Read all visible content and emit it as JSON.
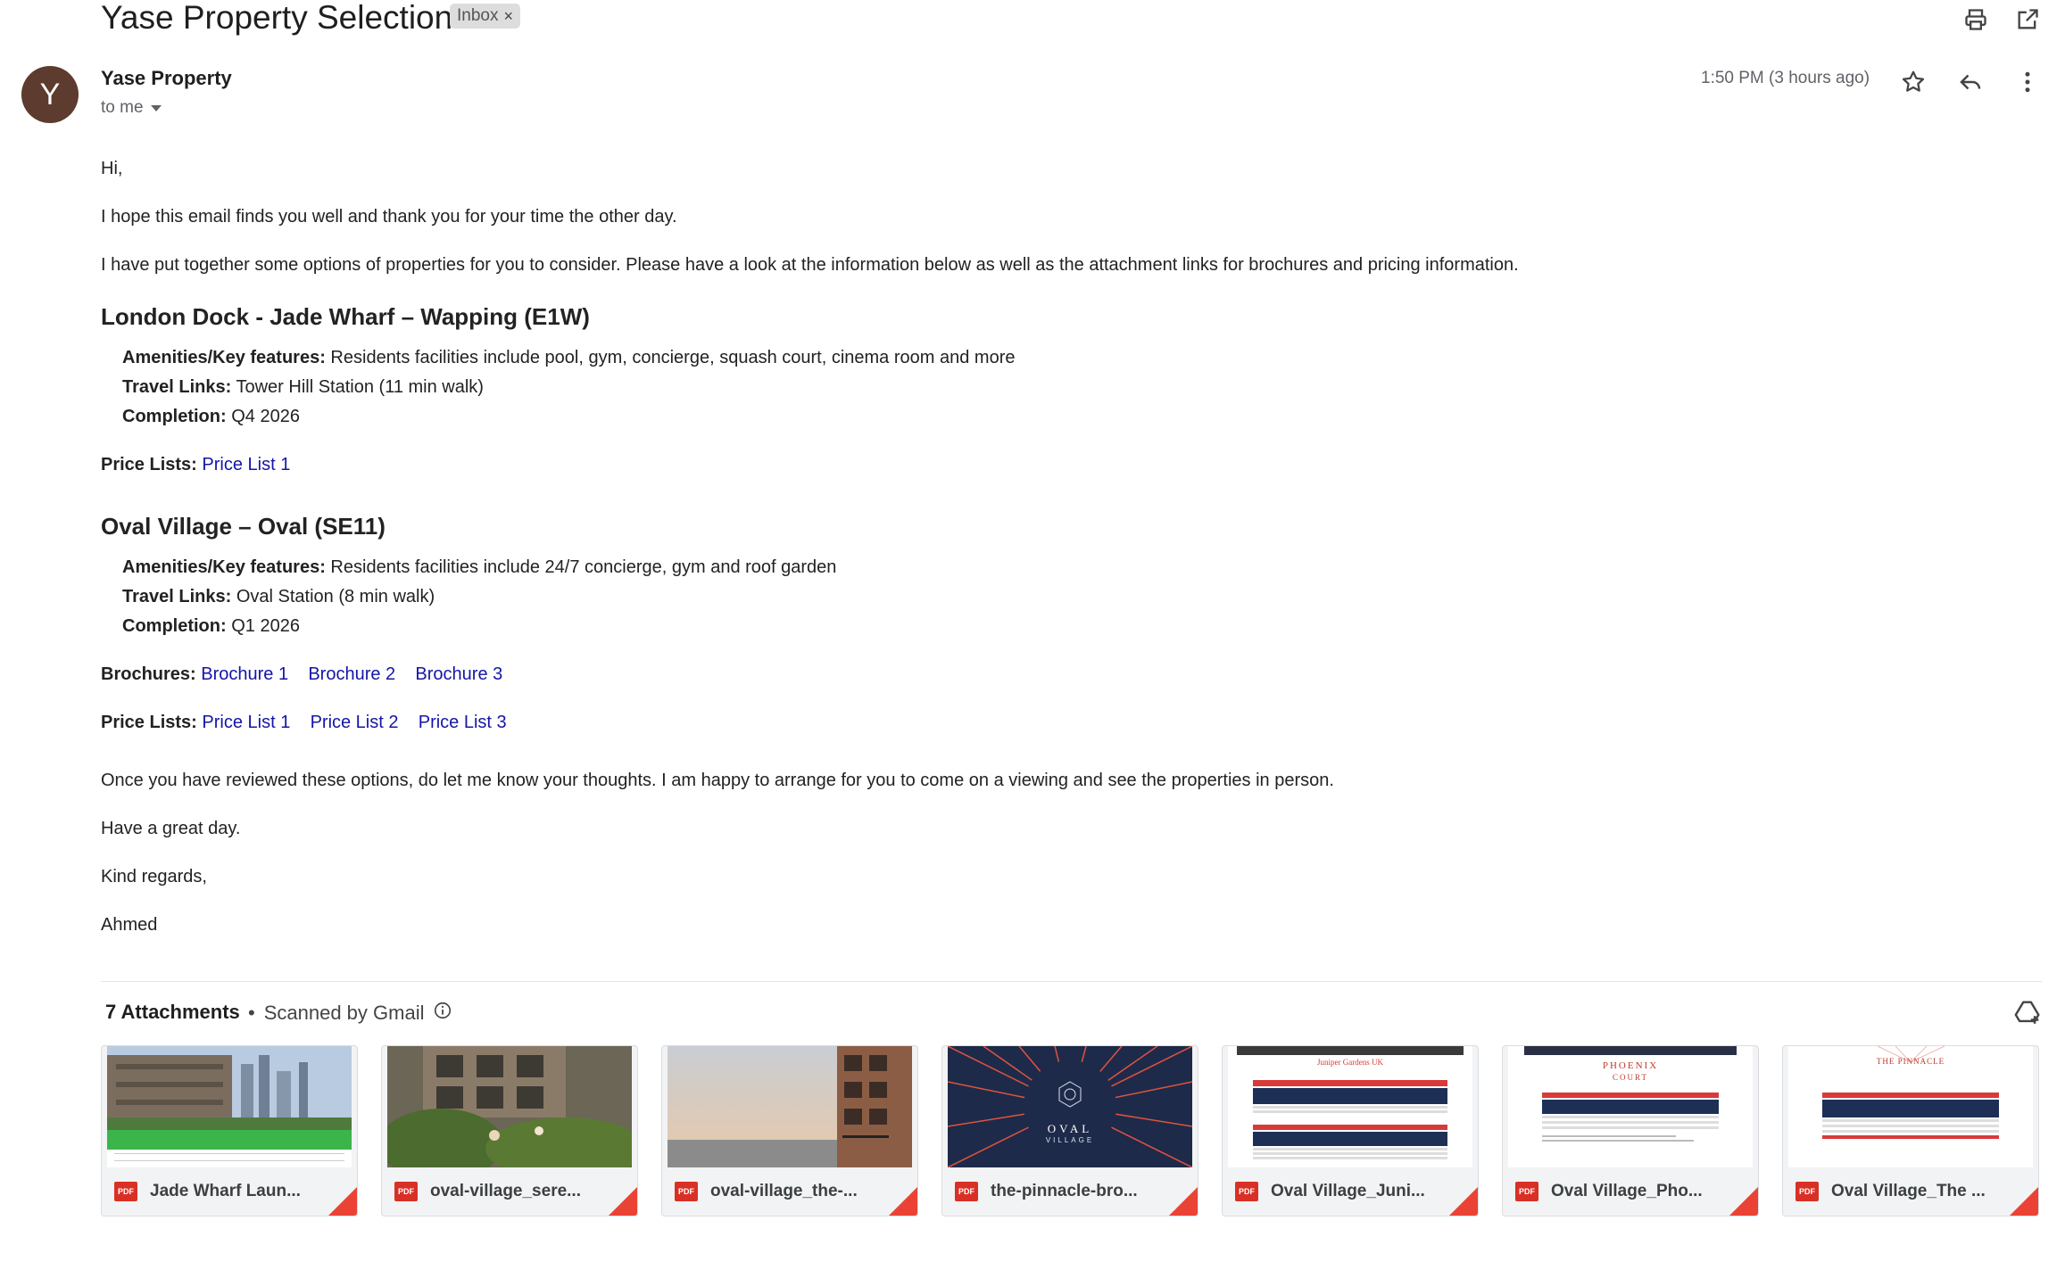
{
  "header": {
    "subject": "Yase Property Selection",
    "label": "Inbox",
    "label_close": "×"
  },
  "sender": {
    "avatar_letter": "Y",
    "name": "Yase Property",
    "to": "to me",
    "time": "1:50 PM (3 hours ago)"
  },
  "body": {
    "greeting": "Hi,",
    "p1": "I hope this email finds you well and thank you for your time the other day.",
    "p2": "I have put together some options of properties for you to consider. Please have a look at the information below as well as the attachment links for brochures and pricing information.",
    "section1": {
      "title": "London Dock - Jade Wharf – Wapping (E1W)",
      "amenities_label": "Amenities/Key features:",
      "amenities": " Residents facilities include pool, gym, concierge, squash court, cinema room and more",
      "travel_label": "Travel Links:",
      "travel": " Tower Hill Station (11 min walk)",
      "completion_label": "Completion:",
      "completion": " Q4 2026",
      "price_label": "Price Lists:",
      "price_links": [
        "Price List 1"
      ]
    },
    "section2": {
      "title": "Oval Village – Oval (SE11)",
      "amenities_label": "Amenities/Key features:",
      "amenities": " Residents facilities include 24/7 concierge, gym and roof garden",
      "travel_label": "Travel Links:",
      "travel": " Oval Station (8 min walk)",
      "completion_label": "Completion:",
      "completion": " Q1 2026",
      "brochure_label": "Brochures:",
      "brochure_links": [
        "Brochure 1",
        "Brochure 2",
        "Brochure 3"
      ],
      "price_label": "Price Lists:",
      "price_links": [
        "Price List 1",
        "Price List 2",
        "Price List 3"
      ]
    },
    "p3": "Once you have reviewed these options, do let me know your thoughts. I am happy to arrange for you to come on a viewing and see the properties in person.",
    "p4": "Have a great day.",
    "p5": "Kind regards,",
    "signature": "Ahmed"
  },
  "attachments": {
    "title": "7 Attachments",
    "scanned": "Scanned by Gmail",
    "items": [
      {
        "name": "Jade Wharf Laun...",
        "type": "PDF"
      },
      {
        "name": "oval-village_sere...",
        "type": "PDF"
      },
      {
        "name": "oval-village_the-...",
        "type": "PDF"
      },
      {
        "name": "the-pinnacle-bro...",
        "type": "PDF"
      },
      {
        "name": "Oval Village_Juni...",
        "type": "PDF"
      },
      {
        "name": "Oval Village_Pho...",
        "type": "PDF"
      },
      {
        "name": "Oval Village_The ...",
        "type": "PDF"
      }
    ],
    "thumb_text": {
      "oval_logo": "OVAL",
      "oval_logo2": "VILLAGE",
      "juniper": "Juniper Gardens UK",
      "phoenix": "PHOENIX",
      "phoenix2": "COURT",
      "pinnacle": "THE PINNACLE"
    }
  }
}
